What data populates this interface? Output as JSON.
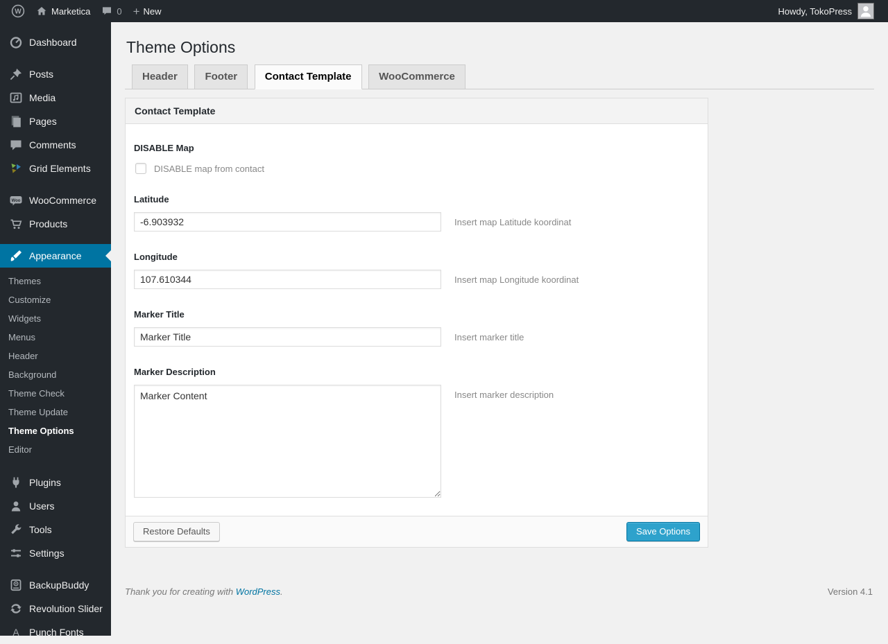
{
  "colors": {
    "adminbar_bg": "#23282d",
    "sidebar_bg": "#23282d",
    "active_blue": "#0074a2",
    "primary_button_blue": "#2ea2cc",
    "page_bg": "#f1f1f1",
    "link_blue": "#0074a2"
  },
  "admin_bar": {
    "site_name": "Marketica",
    "comment_count": "0",
    "new_label": "New",
    "howdy": "Howdy, TokoPress"
  },
  "sidebar": {
    "items": [
      {
        "label": "Dashboard",
        "icon": "dashboard-icon"
      },
      {
        "label": "Posts",
        "icon": "pushpin-icon"
      },
      {
        "label": "Media",
        "icon": "media-icon"
      },
      {
        "label": "Pages",
        "icon": "pages-icon"
      },
      {
        "label": "Comments",
        "icon": "comments-icon"
      },
      {
        "label": "Grid Elements",
        "icon": "grid-elements-icon"
      },
      {
        "label": "WooCommerce",
        "icon": "woocommerce-icon"
      },
      {
        "label": "Products",
        "icon": "cart-icon"
      },
      {
        "label": "Appearance",
        "icon": "brush-icon",
        "active": true
      },
      {
        "label": "Plugins",
        "icon": "plugin-icon"
      },
      {
        "label": "Users",
        "icon": "users-icon"
      },
      {
        "label": "Tools",
        "icon": "wrench-icon"
      },
      {
        "label": "Settings",
        "icon": "settings-icon"
      },
      {
        "label": "BackupBuddy",
        "icon": "backupbuddy-icon"
      },
      {
        "label": "Revolution Slider",
        "icon": "revolution-slider-icon"
      },
      {
        "label": "Punch Fonts",
        "icon": "font-a-icon"
      }
    ],
    "appearance_submenu": [
      {
        "label": "Themes"
      },
      {
        "label": "Customize"
      },
      {
        "label": "Widgets"
      },
      {
        "label": "Menus"
      },
      {
        "label": "Header"
      },
      {
        "label": "Background"
      },
      {
        "label": "Theme Check"
      },
      {
        "label": "Theme Update"
      },
      {
        "label": "Theme Options",
        "active": true
      },
      {
        "label": "Editor"
      }
    ]
  },
  "page": {
    "title": "Theme Options",
    "tabs": [
      {
        "label": "Header"
      },
      {
        "label": "Footer"
      },
      {
        "label": "Contact Template",
        "active": true
      },
      {
        "label": "WooCommerce"
      }
    ],
    "panel_header": "Contact Template",
    "form": {
      "disable_map": {
        "label": "DISABLE Map",
        "checkbox_label": "DISABLE map from contact",
        "checked": false
      },
      "latitude": {
        "label": "Latitude",
        "value": "-6.903932",
        "hint": "Insert map Latitude koordinat"
      },
      "longitude": {
        "label": "Longitude",
        "value": "107.610344",
        "hint": "Insert map Longitude koordinat"
      },
      "marker_title": {
        "label": "Marker Title",
        "value": "Marker Title",
        "hint": "Insert marker title"
      },
      "marker_description": {
        "label": "Marker Description",
        "value": "Marker Content",
        "hint": "Insert marker description"
      }
    },
    "buttons": {
      "restore": "Restore Defaults",
      "save": "Save Options"
    }
  },
  "footer": {
    "thanks": "Thank you for creating with",
    "link": "WordPress",
    "period": ".",
    "version": "Version 4.1"
  }
}
